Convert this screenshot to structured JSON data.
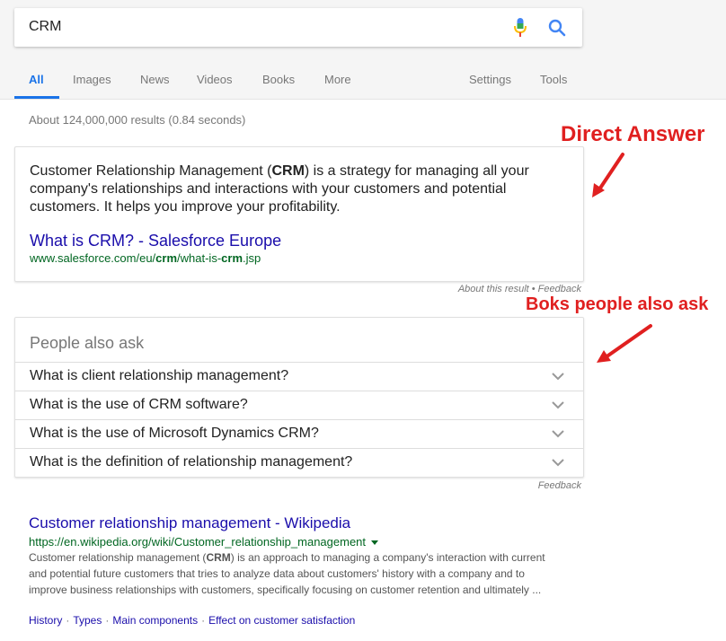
{
  "search": {
    "query": "CRM"
  },
  "tabs": [
    {
      "label": "All",
      "active": true
    },
    {
      "label": "Images"
    },
    {
      "label": "News"
    },
    {
      "label": "Videos"
    },
    {
      "label": "Books"
    },
    {
      "label": "More"
    }
  ],
  "tools_tabs": [
    {
      "label": "Settings"
    },
    {
      "label": "Tools"
    }
  ],
  "result_stats": "About 124,000,000 results (0.84 seconds)",
  "direct_answer": {
    "text_pre": "Customer Relationship Management (",
    "text_bold": "CRM",
    "text_post": ") is a strategy for managing all your company's relationships and interactions with your customers and potential customers. It helps you improve your profitability.",
    "link_title": "What is CRM? - Salesforce Europe",
    "url_pre": "www.salesforce.com/eu/",
    "url_bold1": "crm",
    "url_mid": "/what-is-",
    "url_bold2": "crm",
    "url_post": ".jsp",
    "about": "About this result • Feedback"
  },
  "people_also_ask": {
    "title": "People also ask",
    "questions": [
      "What is client relationship management?",
      "What is the use of CRM software?",
      "What is the use of Microsoft Dynamics CRM?",
      "What is the definition of relationship management?"
    ],
    "feedback": "Feedback"
  },
  "result": {
    "title": "Customer relationship management - Wikipedia",
    "url": "https://en.wikipedia.org/wiki/Customer_relationship_management",
    "desc_pre": "Customer relationship management (",
    "desc_bold": "CRM",
    "desc_post": ") is an approach to managing a company's interaction with current and potential future customers that tries to analyze data about customers' history with a company and to improve business relationships with customers, specifically focusing on customer retention and ultimately ...",
    "sitelinks": [
      "History",
      "Types",
      "Main components",
      "Effect on customer satisfaction"
    ]
  },
  "annotations": {
    "direct_answer": "Direct Answer",
    "people_also_ask": "Boks people also ask"
  },
  "colors": {
    "accent_blue": "#1a73e8",
    "link": "#1a0dab",
    "url_green": "#006621",
    "annotation_red": "#e02020"
  }
}
